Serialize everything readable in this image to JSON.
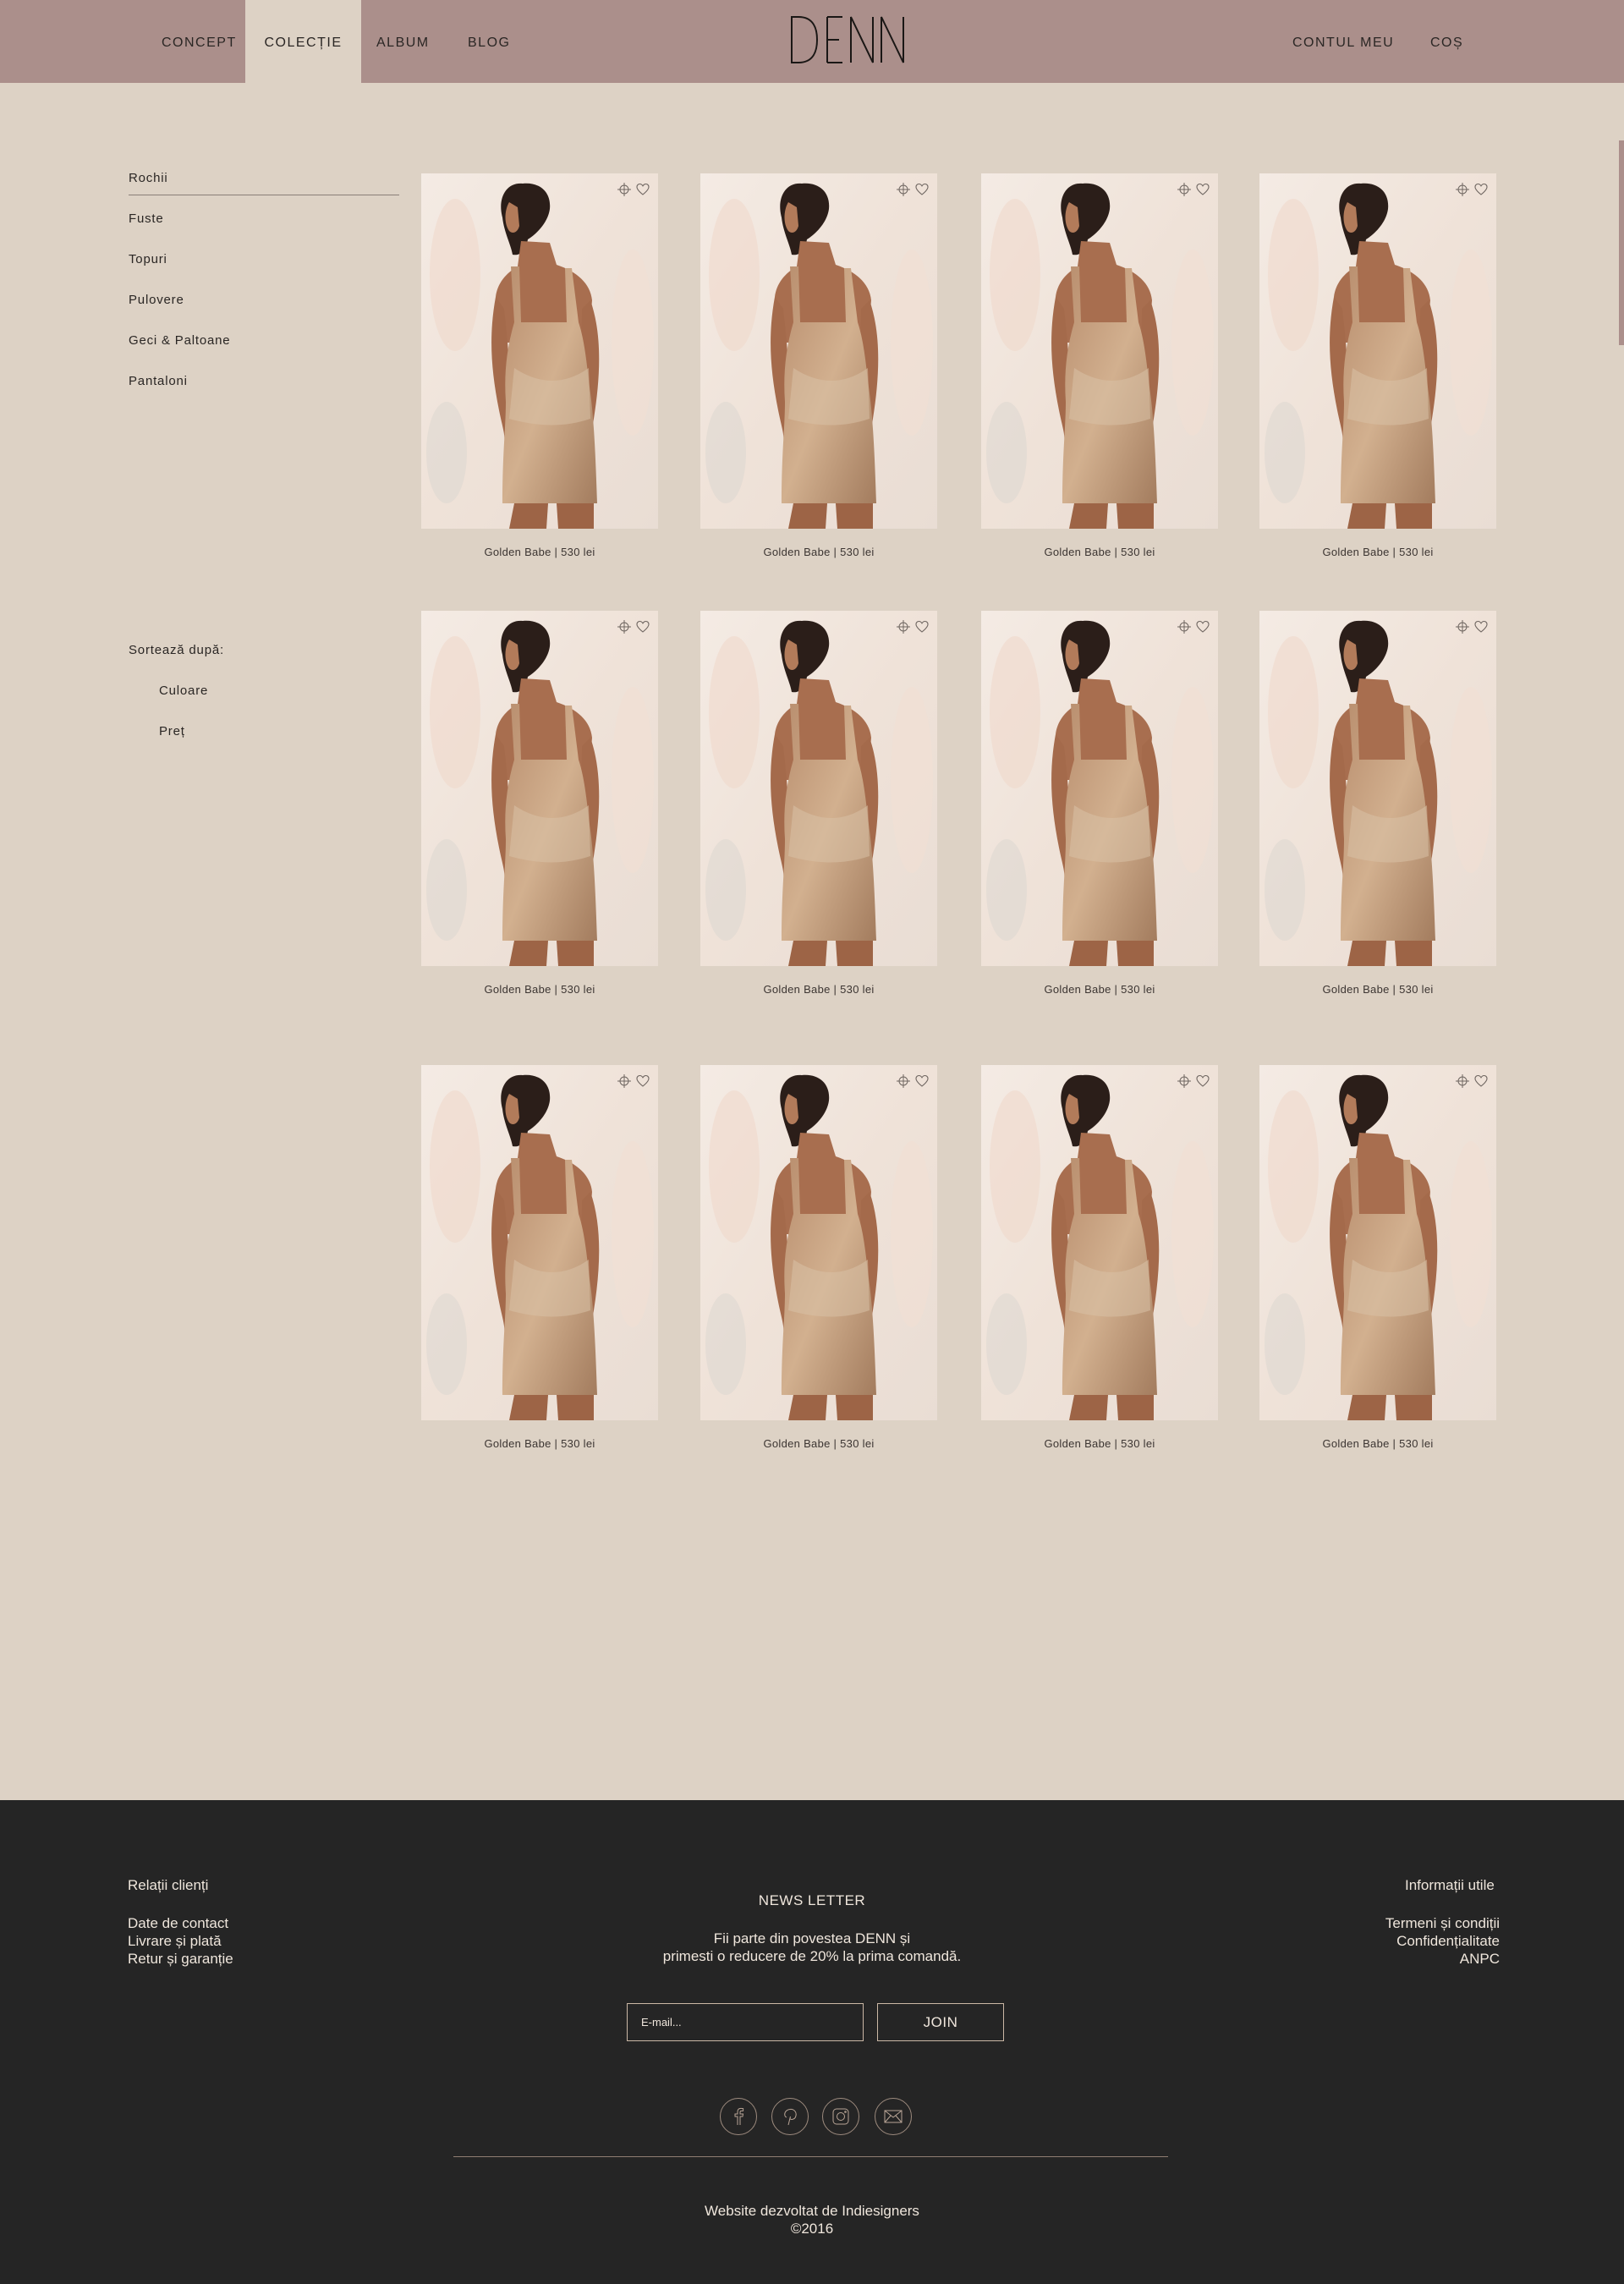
{
  "header": {
    "nav_left": [
      "CONCEPT",
      "COLECȚIE",
      "ALBUM",
      "BLOG"
    ],
    "active_tab": "COLECȚIE",
    "logo_text": "DENN",
    "nav_right": [
      "CONTUL MEU",
      "COȘ"
    ]
  },
  "sidebar": {
    "categories": [
      "Rochii",
      "Fuste",
      "Topuri",
      "Pulovere",
      "Geci & Paltoane",
      "Pantaloni"
    ],
    "active_category": "Rochii",
    "sort_label": "Sortează după:",
    "sort_options": [
      "Culoare",
      "Preț"
    ]
  },
  "products": [
    {
      "caption": "Golden Babe | 530 lei"
    },
    {
      "caption": "Golden Babe | 530 lei"
    },
    {
      "caption": "Golden Babe | 530 lei"
    },
    {
      "caption": "Golden Babe | 530 lei"
    },
    {
      "caption": "Golden Babe | 530 lei"
    },
    {
      "caption": "Golden Babe | 530 lei"
    },
    {
      "caption": "Golden Babe | 530 lei"
    },
    {
      "caption": "Golden Babe | 530 lei"
    },
    {
      "caption": "Golden Babe | 530 lei"
    },
    {
      "caption": "Golden Babe | 530 lei"
    },
    {
      "caption": "Golden Babe | 530 lei"
    },
    {
      "caption": "Golden Babe | 530 lei"
    }
  ],
  "footer": {
    "left_heading": "Relații clienți",
    "left_links": [
      "Date de contact",
      "Livrare și plată",
      "Retur și garanție"
    ],
    "newsletter_title": "NEWS LETTER",
    "newsletter_line1": "Fii parte din povestea DENN și",
    "newsletter_line2": "primesti o reducere de 20% la prima comandă.",
    "email_placeholder": "E-mail...",
    "join_label": "JOIN",
    "social_icons": [
      "facebook-icon",
      "pinterest-icon",
      "instagram-icon",
      "mail-icon"
    ],
    "right_heading": "Informații utile",
    "right_links": [
      "Termeni și condiții",
      "Confidențialitate",
      "ANPC"
    ],
    "credit": "Website dezvoltat de Indiesigners",
    "copyright": "©2016"
  },
  "colors": {
    "header_bg": "#ab8f8b",
    "page_bg": "#ddd2c5",
    "footer_bg": "#252525",
    "footer_text": "#efe6dc"
  }
}
